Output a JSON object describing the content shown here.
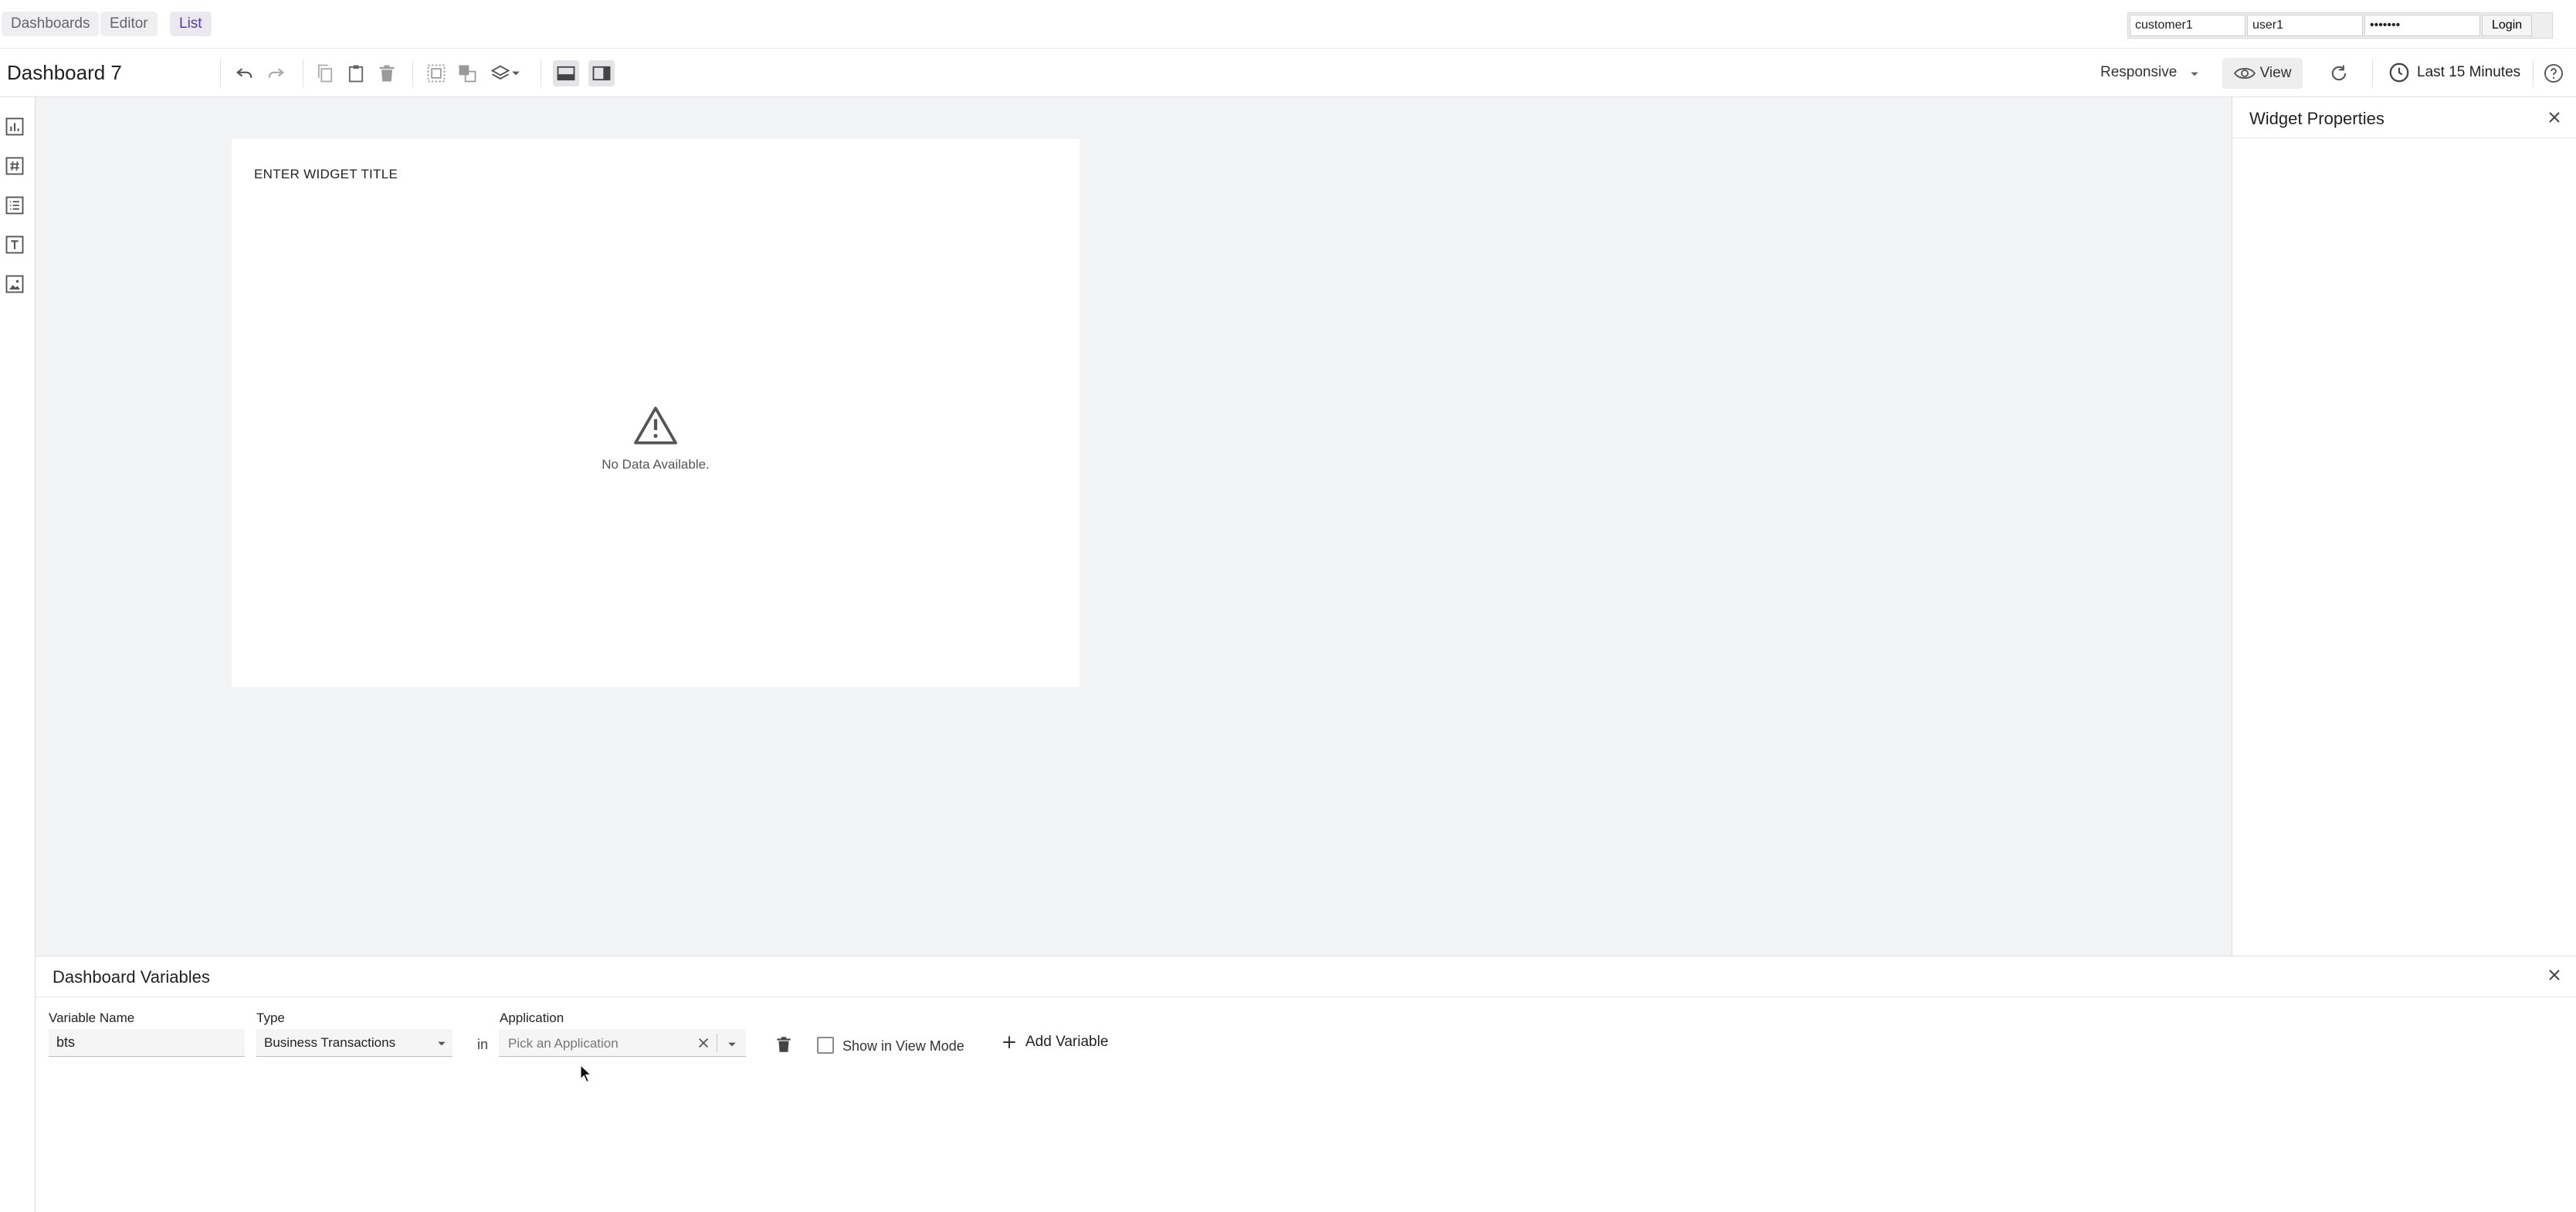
{
  "nav": {
    "tabs": [
      {
        "label": "Dashboards"
      },
      {
        "label": "Editor"
      },
      {
        "label": "List"
      }
    ],
    "active_tab": "List"
  },
  "login": {
    "customer_value": "customer1",
    "user_value": "user1",
    "password_value": "1234567",
    "button_label": "Login"
  },
  "toolbar": {
    "dashboard_title": "Dashboard 7",
    "layout_mode": "Responsive",
    "view_label": "View",
    "time_range": "Last 15 Minutes"
  },
  "widget": {
    "title": "ENTER WIDGET TITLE",
    "empty_message": "No Data Available."
  },
  "properties_panel": {
    "title": "Widget Properties"
  },
  "variables_panel": {
    "title": "Dashboard Variables",
    "labels": {
      "variable_name": "Variable Name",
      "type": "Type",
      "application": "Application"
    },
    "row": {
      "name": "bts",
      "type": "Business Transactions",
      "connector": "in",
      "application_placeholder": "Pick an Application",
      "show_in_view_mode_label": "Show in View Mode",
      "show_in_view_mode_checked": false
    },
    "add_variable_label": "Add Variable"
  },
  "colors": {
    "accent": "#553e8f",
    "canvas_background": "#f2f3f5",
    "active_tab_background": "#ebe8f2"
  }
}
